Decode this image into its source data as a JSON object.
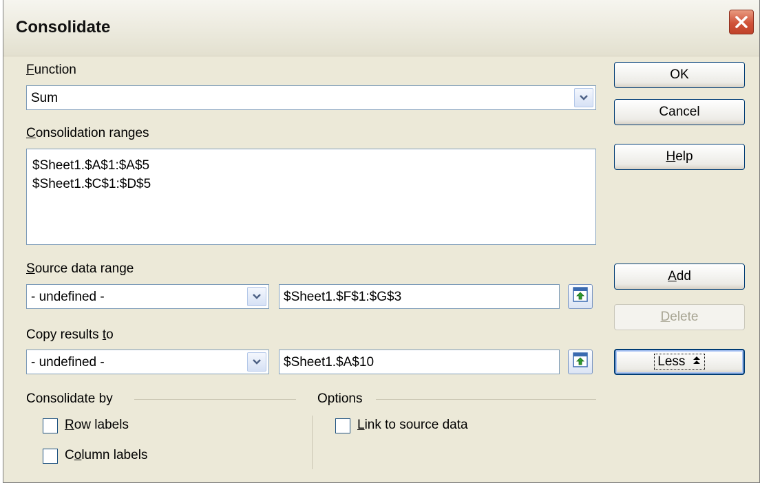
{
  "dialog": {
    "title": "Consolidate"
  },
  "function": {
    "label_accel": "F",
    "label_rest": "unction",
    "value": "Sum"
  },
  "consolidation_ranges": {
    "label_accel": "C",
    "label_rest": "onsolidation ranges",
    "items": [
      "$Sheet1.$A$1:$A$5",
      "$Sheet1.$C$1:$D$5"
    ]
  },
  "source_data_range": {
    "label_accel": "S",
    "label_rest": "ource data range",
    "select_value": "- undefined -",
    "input_value": "$Sheet1.$F$1:$G$3"
  },
  "copy_results_to": {
    "label_pre": "Copy results ",
    "label_accel": "t",
    "label_rest": "o",
    "select_value": "- undefined -",
    "input_value": "$Sheet1.$A$10"
  },
  "buttons": {
    "ok": "OK",
    "cancel": "Cancel",
    "help_accel": "H",
    "help_rest": "elp",
    "add_accel": "A",
    "add_rest": "dd",
    "delete_accel": "D",
    "delete_rest": "elete",
    "less": "Less"
  },
  "consolidate_by": {
    "title": "Consolidate by",
    "row_labels_accel": "R",
    "row_labels_rest": "ow labels",
    "column_labels_pre": "C",
    "column_labels_accel": "o",
    "column_labels_rest": "lumn labels",
    "row_labels_checked": false,
    "column_labels_checked": false
  },
  "options": {
    "title": "Options",
    "link_accel": "L",
    "link_rest": "ink to source data",
    "link_checked": false
  },
  "icons": {
    "close": "close-icon",
    "dropdown": "chevron-down-icon",
    "shrink": "shrink-dialog-icon",
    "less_arrow": "double-up-arrow-icon"
  }
}
